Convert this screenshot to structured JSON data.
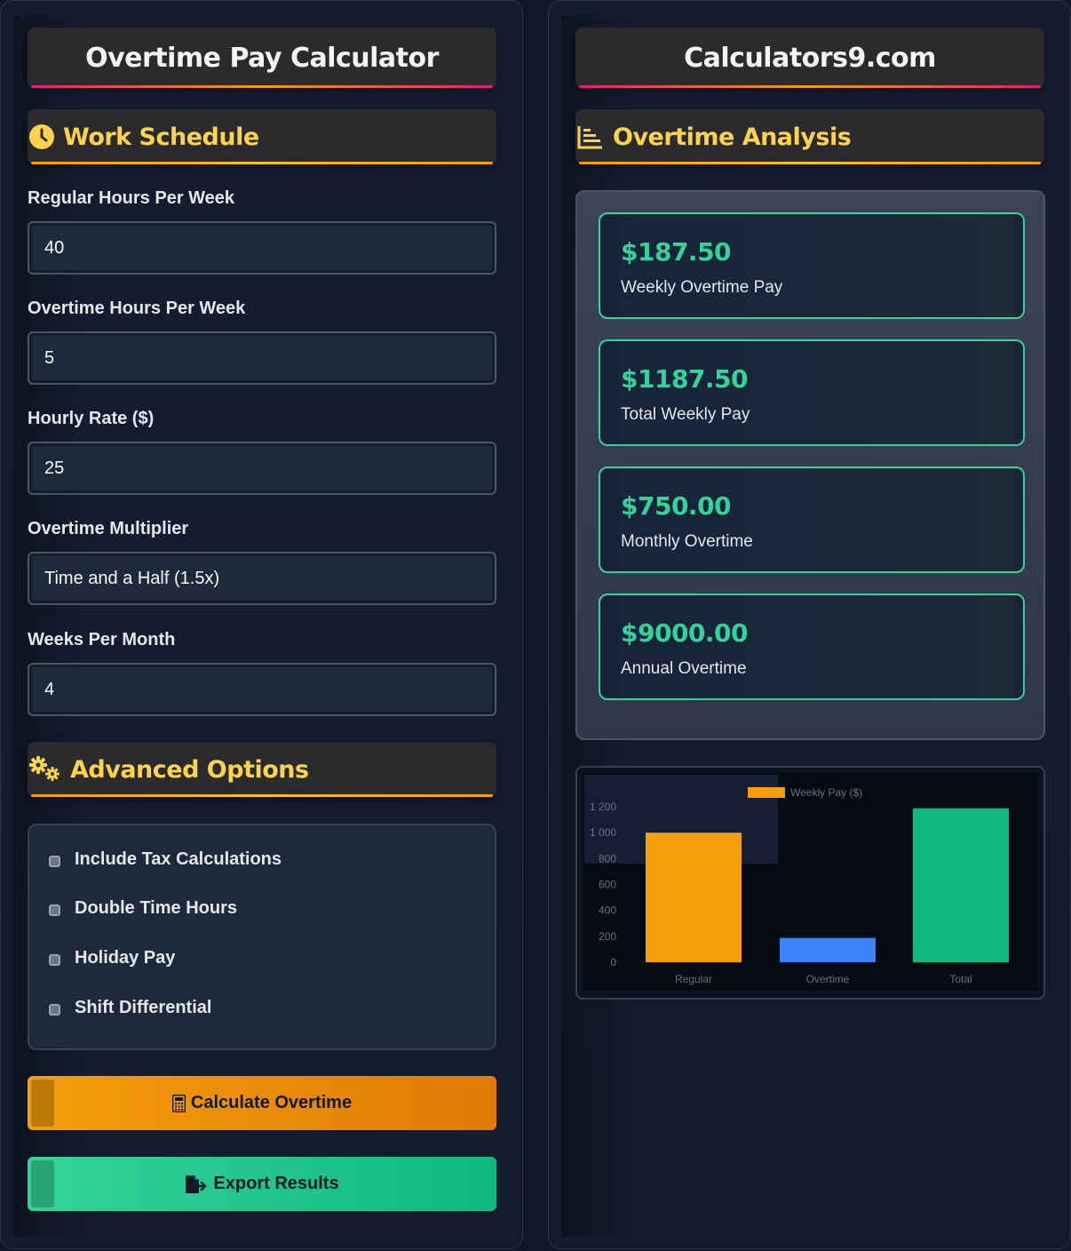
{
  "left": {
    "title": "Overtime Pay Calculator",
    "work_schedule": {
      "heading": "Work Schedule",
      "icon": "clock-icon",
      "fields": [
        {
          "label": "Regular Hours Per Week",
          "value": "40"
        },
        {
          "label": "Overtime Hours Per Week",
          "value": "5"
        },
        {
          "label": "Hourly Rate ($)",
          "value": "25"
        },
        {
          "label": "Overtime Multiplier",
          "value": "Time and a Half (1.5x)"
        },
        {
          "label": "Weeks Per Month",
          "value": "4"
        }
      ]
    },
    "advanced": {
      "heading": "Advanced Options",
      "icon": "gears-icon",
      "options": [
        {
          "label": "Include Tax Calculations"
        },
        {
          "label": "Double Time Hours"
        },
        {
          "label": "Holiday Pay"
        },
        {
          "label": "Shift Differential"
        }
      ]
    },
    "buttons": {
      "calculate": "Calculate Overtime",
      "export": "Export Results"
    }
  },
  "right": {
    "title": "Calculators9.com",
    "analysis_heading": "Overtime Analysis",
    "analysis_icon": "bar-chart-icon",
    "stats": [
      {
        "value": "$187.50",
        "label": "Weekly Overtime Pay"
      },
      {
        "value": "$1187.50",
        "label": "Total Weekly Pay"
      },
      {
        "value": "$750.00",
        "label": "Monthly Overtime"
      },
      {
        "value": "$9000.00",
        "label": "Annual Overtime"
      }
    ]
  },
  "chart_data": {
    "type": "bar",
    "categories": [
      "Regular",
      "Overtime",
      "Total"
    ],
    "series": [
      {
        "name": "Weekly Pay ($)",
        "values": [
          1000,
          187.5,
          1187.5
        ]
      }
    ],
    "colors": [
      "#f59e0b",
      "#3b82f6",
      "#10b981"
    ],
    "yticks": [
      "1 200",
      "1 000",
      "800",
      "600",
      "400",
      "200",
      "0"
    ],
    "ylim": [
      0,
      1200
    ],
    "legend": "top-center"
  },
  "colors": {
    "accent": "#fcd34d",
    "success": "#34d399",
    "orange": "#f59e0b"
  }
}
